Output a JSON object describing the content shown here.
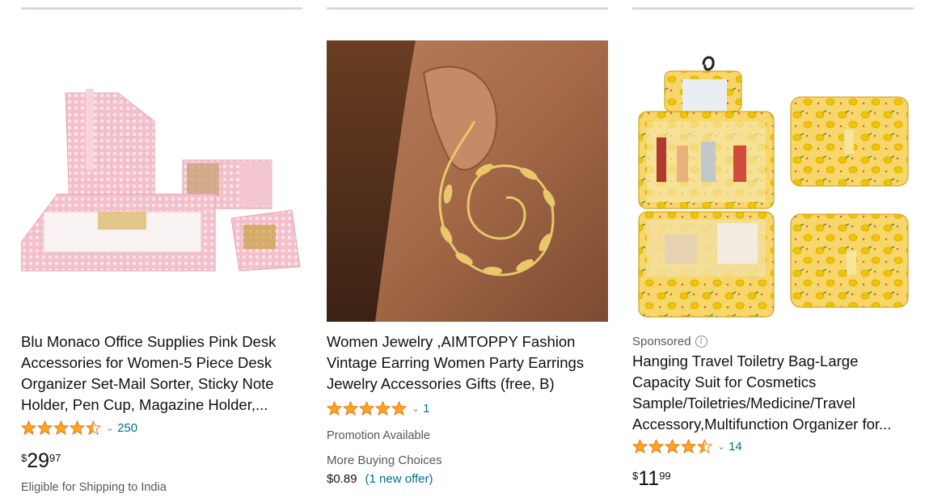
{
  "products": [
    {
      "title": "Blu Monaco Office Supplies Pink Desk Accessories for Women-5 Piece Desk Organizer Set-Mail Sorter, Sticky Note Holder, Pen Cup, Magazine Holder,...",
      "rating": 4.5,
      "review_count": "250",
      "price": {
        "symbol": "$",
        "whole": "29",
        "fraction": "97"
      },
      "shipping": "Eligible for Shipping to India",
      "image_icon": "pink-desk-organizer-image"
    },
    {
      "title": "Women Jewelry ,AIMTOPPY Fashion Vintage Earring Women Party Earrings Jewelry Accessories Gifts (free, B)",
      "rating": 5,
      "review_count": "1",
      "promotion": "Promotion Available",
      "more_buying": "More Buying Choices",
      "offer_price": "$0.89",
      "offer_link": "(1 new offer)",
      "image_icon": "spiral-earring-image"
    },
    {
      "sponsored": "Sponsored",
      "title": "Hanging Travel Toiletry Bag-Large Capacity Suit for Cosmetics Sample/Toiletries/Medicine/Travel Accessory,Multifunction Organizer for...",
      "rating": 4.5,
      "review_count": "14",
      "price": {
        "symbol": "$",
        "whole": "11",
        "fraction": "99"
      },
      "image_icon": "lemon-toiletry-bag-image"
    }
  ],
  "colors": {
    "star": "#ffa41c",
    "star_stroke": "#de7921",
    "link": "#007185",
    "divider": "#d5d9d9"
  }
}
